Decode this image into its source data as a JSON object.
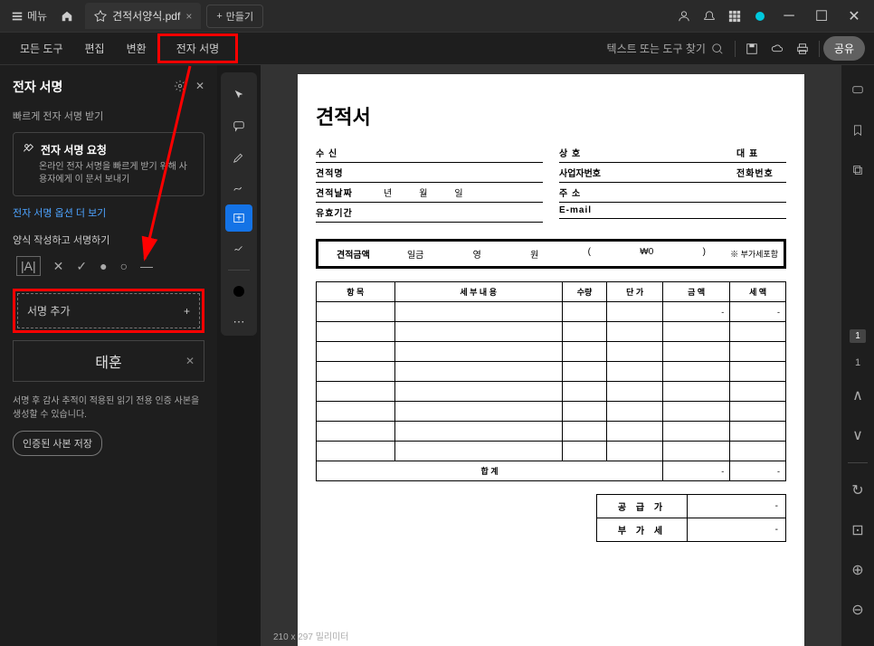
{
  "titleBar": {
    "menu": "메뉴",
    "tabName": "견적서양식.pdf",
    "newTab": "만들기"
  },
  "toolBar": {
    "allTools": "모든 도구",
    "edit": "편집",
    "convert": "변환",
    "sign": "전자 서명",
    "searchPlaceholder": "텍스트 또는 도구 찾기",
    "share": "공유"
  },
  "signPanel": {
    "title": "전자 서명",
    "quickSignLabel": "빠르게 전자 서명 받기",
    "requestTitle": "전자 서명 요청",
    "requestDesc": "온라인 전자 서명을 빠르게 받기 위해 사용자에게 이 문서 보내기",
    "moreOptions": "전자 서명 옵션 더 보기",
    "fillSignLabel": "양식 작성하고 서명하기",
    "addSignature": "서명 추가",
    "signatureName": "태훈",
    "auditText": "서명 후 감사 추적이 적용된 읽기 전용 인증 사본을 생성할 수 있습니다.",
    "certCopy": "인증된 사본 저장"
  },
  "document": {
    "title": "견적서",
    "fields": {
      "recipient": "수  신",
      "quoteName": "견적명",
      "quoteDate": "견적날짜",
      "year": "년",
      "month": "월",
      "day": "일",
      "validity": "유효기간",
      "company": "상  호",
      "rep": "대  표",
      "bizNum": "사업자번호",
      "phone": "전화번호",
      "address": "주  소",
      "email": "E-mail"
    },
    "amount": {
      "label": "견적금액",
      "ilgum": "일금",
      "yeong": "영",
      "won": "원",
      "paren1": "(",
      "value": "₩0",
      "paren2": ")",
      "note": "※ 부가세포함"
    },
    "table": {
      "headers": [
        "항  목",
        "세 부 내 용",
        "수량",
        "단 가",
        "금  액",
        "세  액"
      ],
      "sum": "합    계",
      "dash": "-"
    },
    "summary": {
      "supply": "공 급 가",
      "vat": "부 가 세"
    },
    "pageDims": "210 x 297 밀리미터"
  },
  "rightRail": {
    "pageNum": "1",
    "pageGoto": "1"
  }
}
